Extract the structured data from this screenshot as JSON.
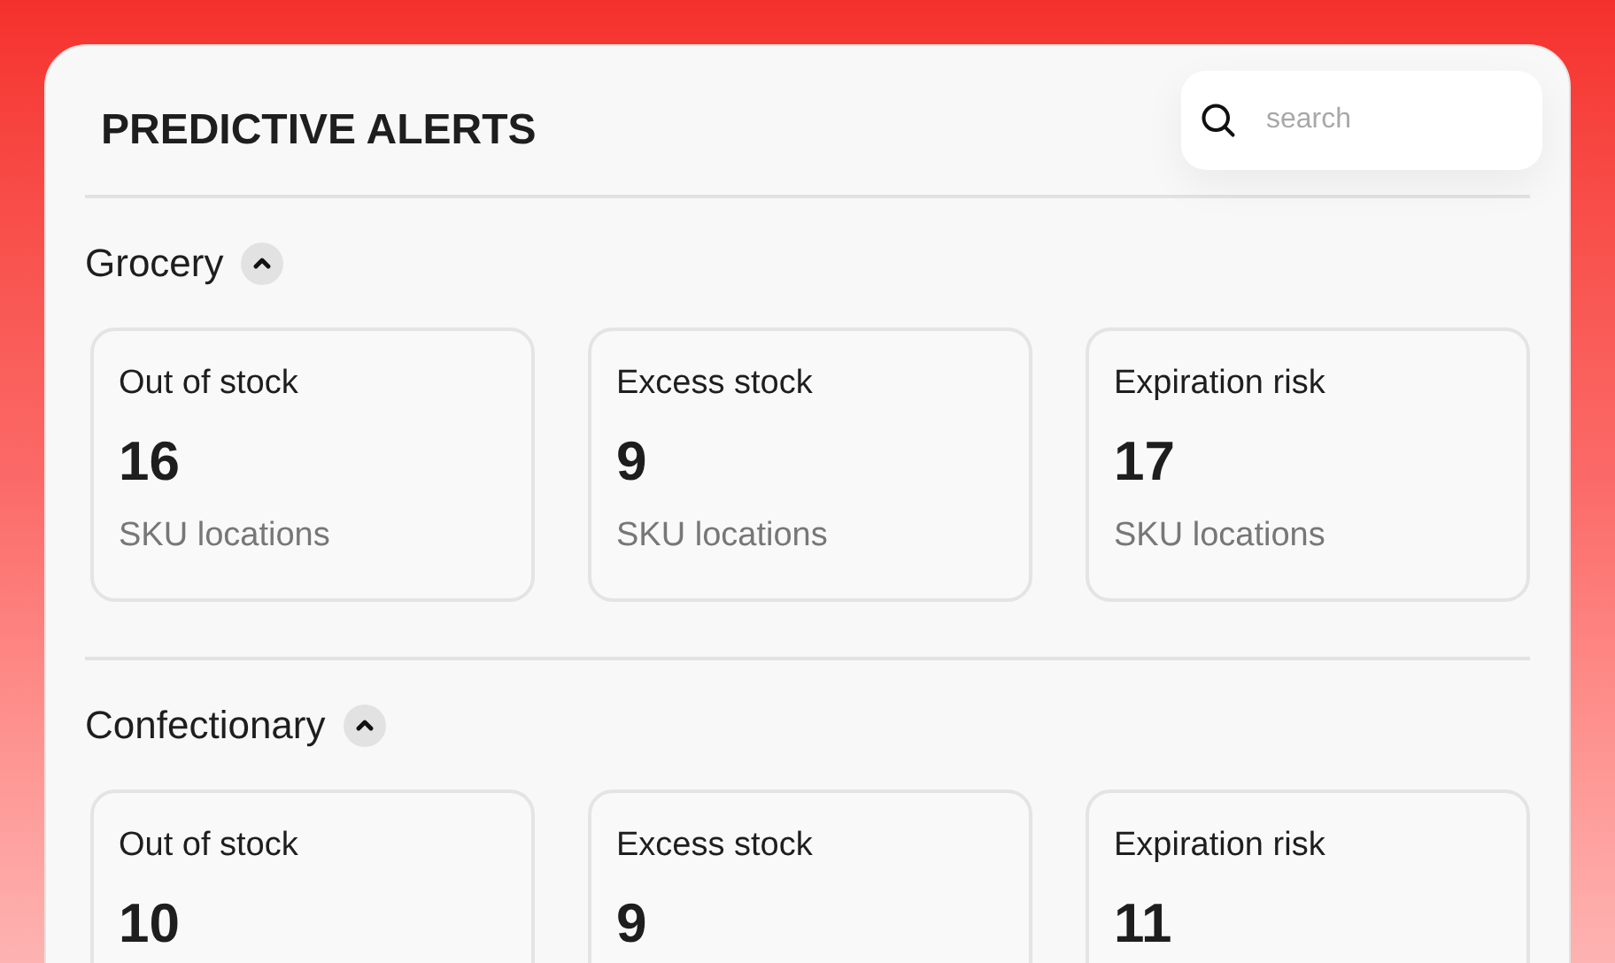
{
  "title": "PREDICTIVE ALERTS",
  "search": {
    "placeholder": "search"
  },
  "sections": [
    {
      "name": "Grocery",
      "expanded": true,
      "cards": [
        {
          "label": "Out of stock",
          "value": "16",
          "unit": "SKU locations"
        },
        {
          "label": "Excess stock",
          "value": "9",
          "unit": "SKU locations"
        },
        {
          "label": "Expiration risk",
          "value": "17",
          "unit": "SKU locations"
        }
      ]
    },
    {
      "name": "Confectionary",
      "expanded": true,
      "cards": [
        {
          "label": "Out of stock",
          "value": "10"
        },
        {
          "label": "Excess stock",
          "value": "9"
        },
        {
          "label": "Expiration risk",
          "value": "11"
        }
      ]
    }
  ]
}
